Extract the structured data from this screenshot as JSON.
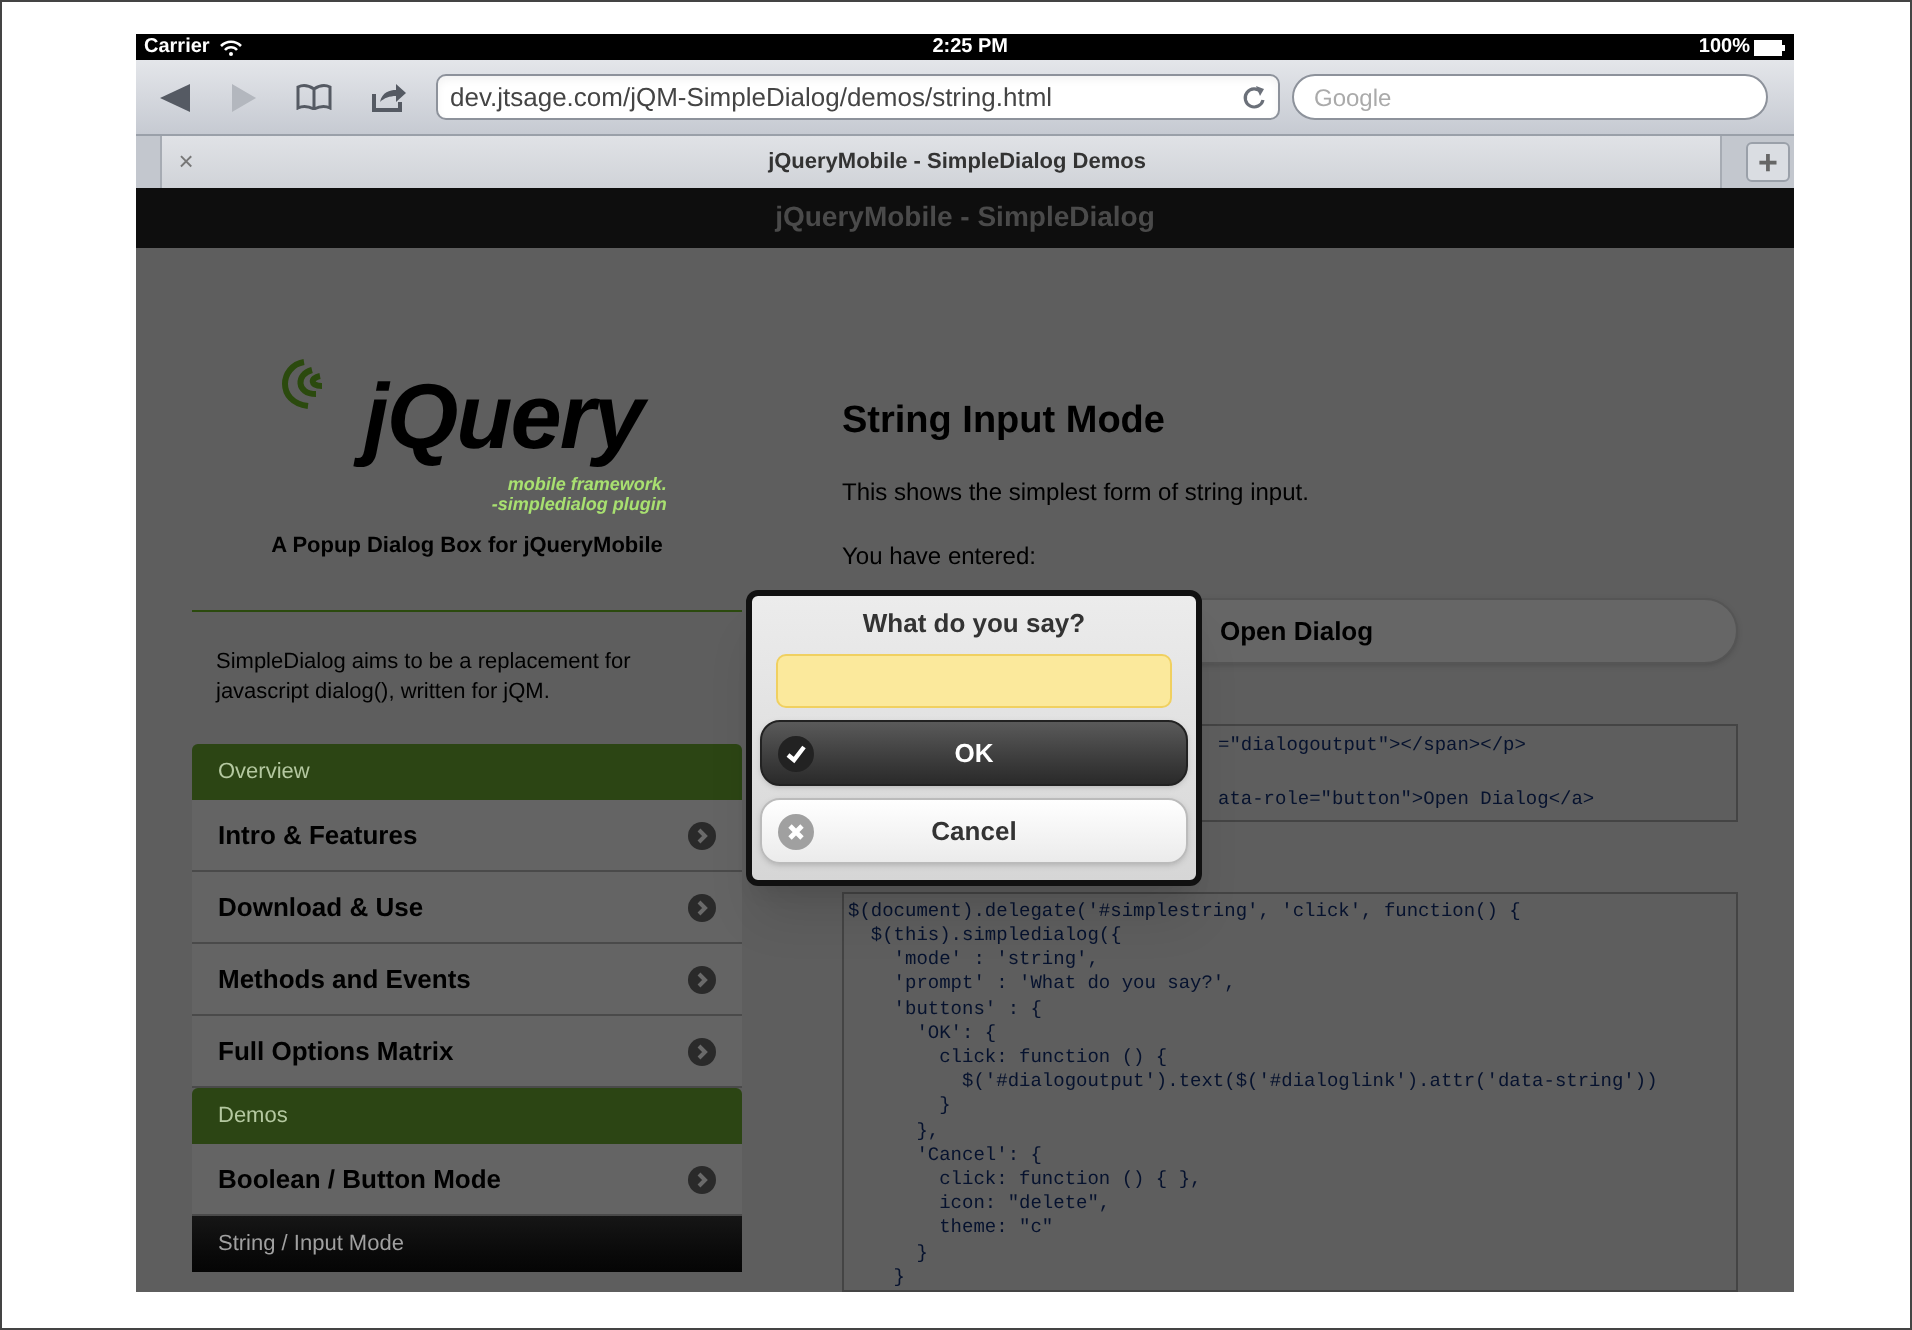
{
  "status_bar": {
    "carrier": "Carrier",
    "time": "2:25 PM",
    "battery": "100%"
  },
  "toolbar": {
    "url": "dev.jtsage.com/jQM-SimpleDialog/demos/string.html",
    "search": {
      "placeholder": "Google"
    }
  },
  "tab_bar": {
    "close": "×",
    "title": "jQueryMobile - SimpleDialog Demos",
    "new_tab": "+"
  },
  "page_header": {
    "title": "jQueryMobile - SimpleDialog"
  },
  "sidebar": {
    "logo": {
      "wordmark": "jQuery",
      "subtitle": [
        "mobile framework.",
        "-simpledialog plugin"
      ]
    },
    "tagline": "A Popup Dialog Box for jQueryMobile",
    "description": "SimpleDialog aims to be a replacement for javascript dialog(), written for jQM.",
    "nav": [
      {
        "kind": "header",
        "label": "Overview",
        "selected": false
      },
      {
        "kind": "item",
        "label": "Intro & Features"
      },
      {
        "kind": "item",
        "label": "Download & Use"
      },
      {
        "kind": "item",
        "label": "Methods and Events"
      },
      {
        "kind": "item",
        "label": "Full Options Matrix"
      },
      {
        "kind": "header",
        "label": "Demos",
        "selected": false
      },
      {
        "kind": "item",
        "label": "Boolean / Button Mode"
      },
      {
        "kind": "header",
        "label": "String / Input Mode",
        "selected": true
      }
    ]
  },
  "main": {
    "title": "String Input Mode",
    "intro": "This shows the simplest form of string input.",
    "output_label": "You have entered:",
    "open_button": "Open Dialog",
    "html_snippet": [
      "=\"dialogoutput\"></span></p>",
      "ata-role=\"button\">Open Dialog</a>"
    ],
    "js_snippet": [
      "$(document).delegate('#simplestring', 'click', function() {",
      "  $(this).simpledialog({",
      "    'mode' : 'string',",
      "    'prompt' : 'What do you say?',",
      "    'buttons' : {",
      "      'OK': {",
      "        click: function () {",
      "          $('#dialogoutput').text($('#dialoglink').attr('data-string'))",
      "        }",
      "      },",
      "      'Cancel': {",
      "        click: function () { },",
      "        icon: \"delete\",",
      "        theme: \"c\"",
      "      }",
      "    }"
    ]
  },
  "dialog": {
    "prompt": "What do you say?",
    "buttons": [
      {
        "kind": "confirm",
        "label": "OK"
      },
      {
        "kind": "cancel",
        "label": "Cancel"
      }
    ]
  }
}
